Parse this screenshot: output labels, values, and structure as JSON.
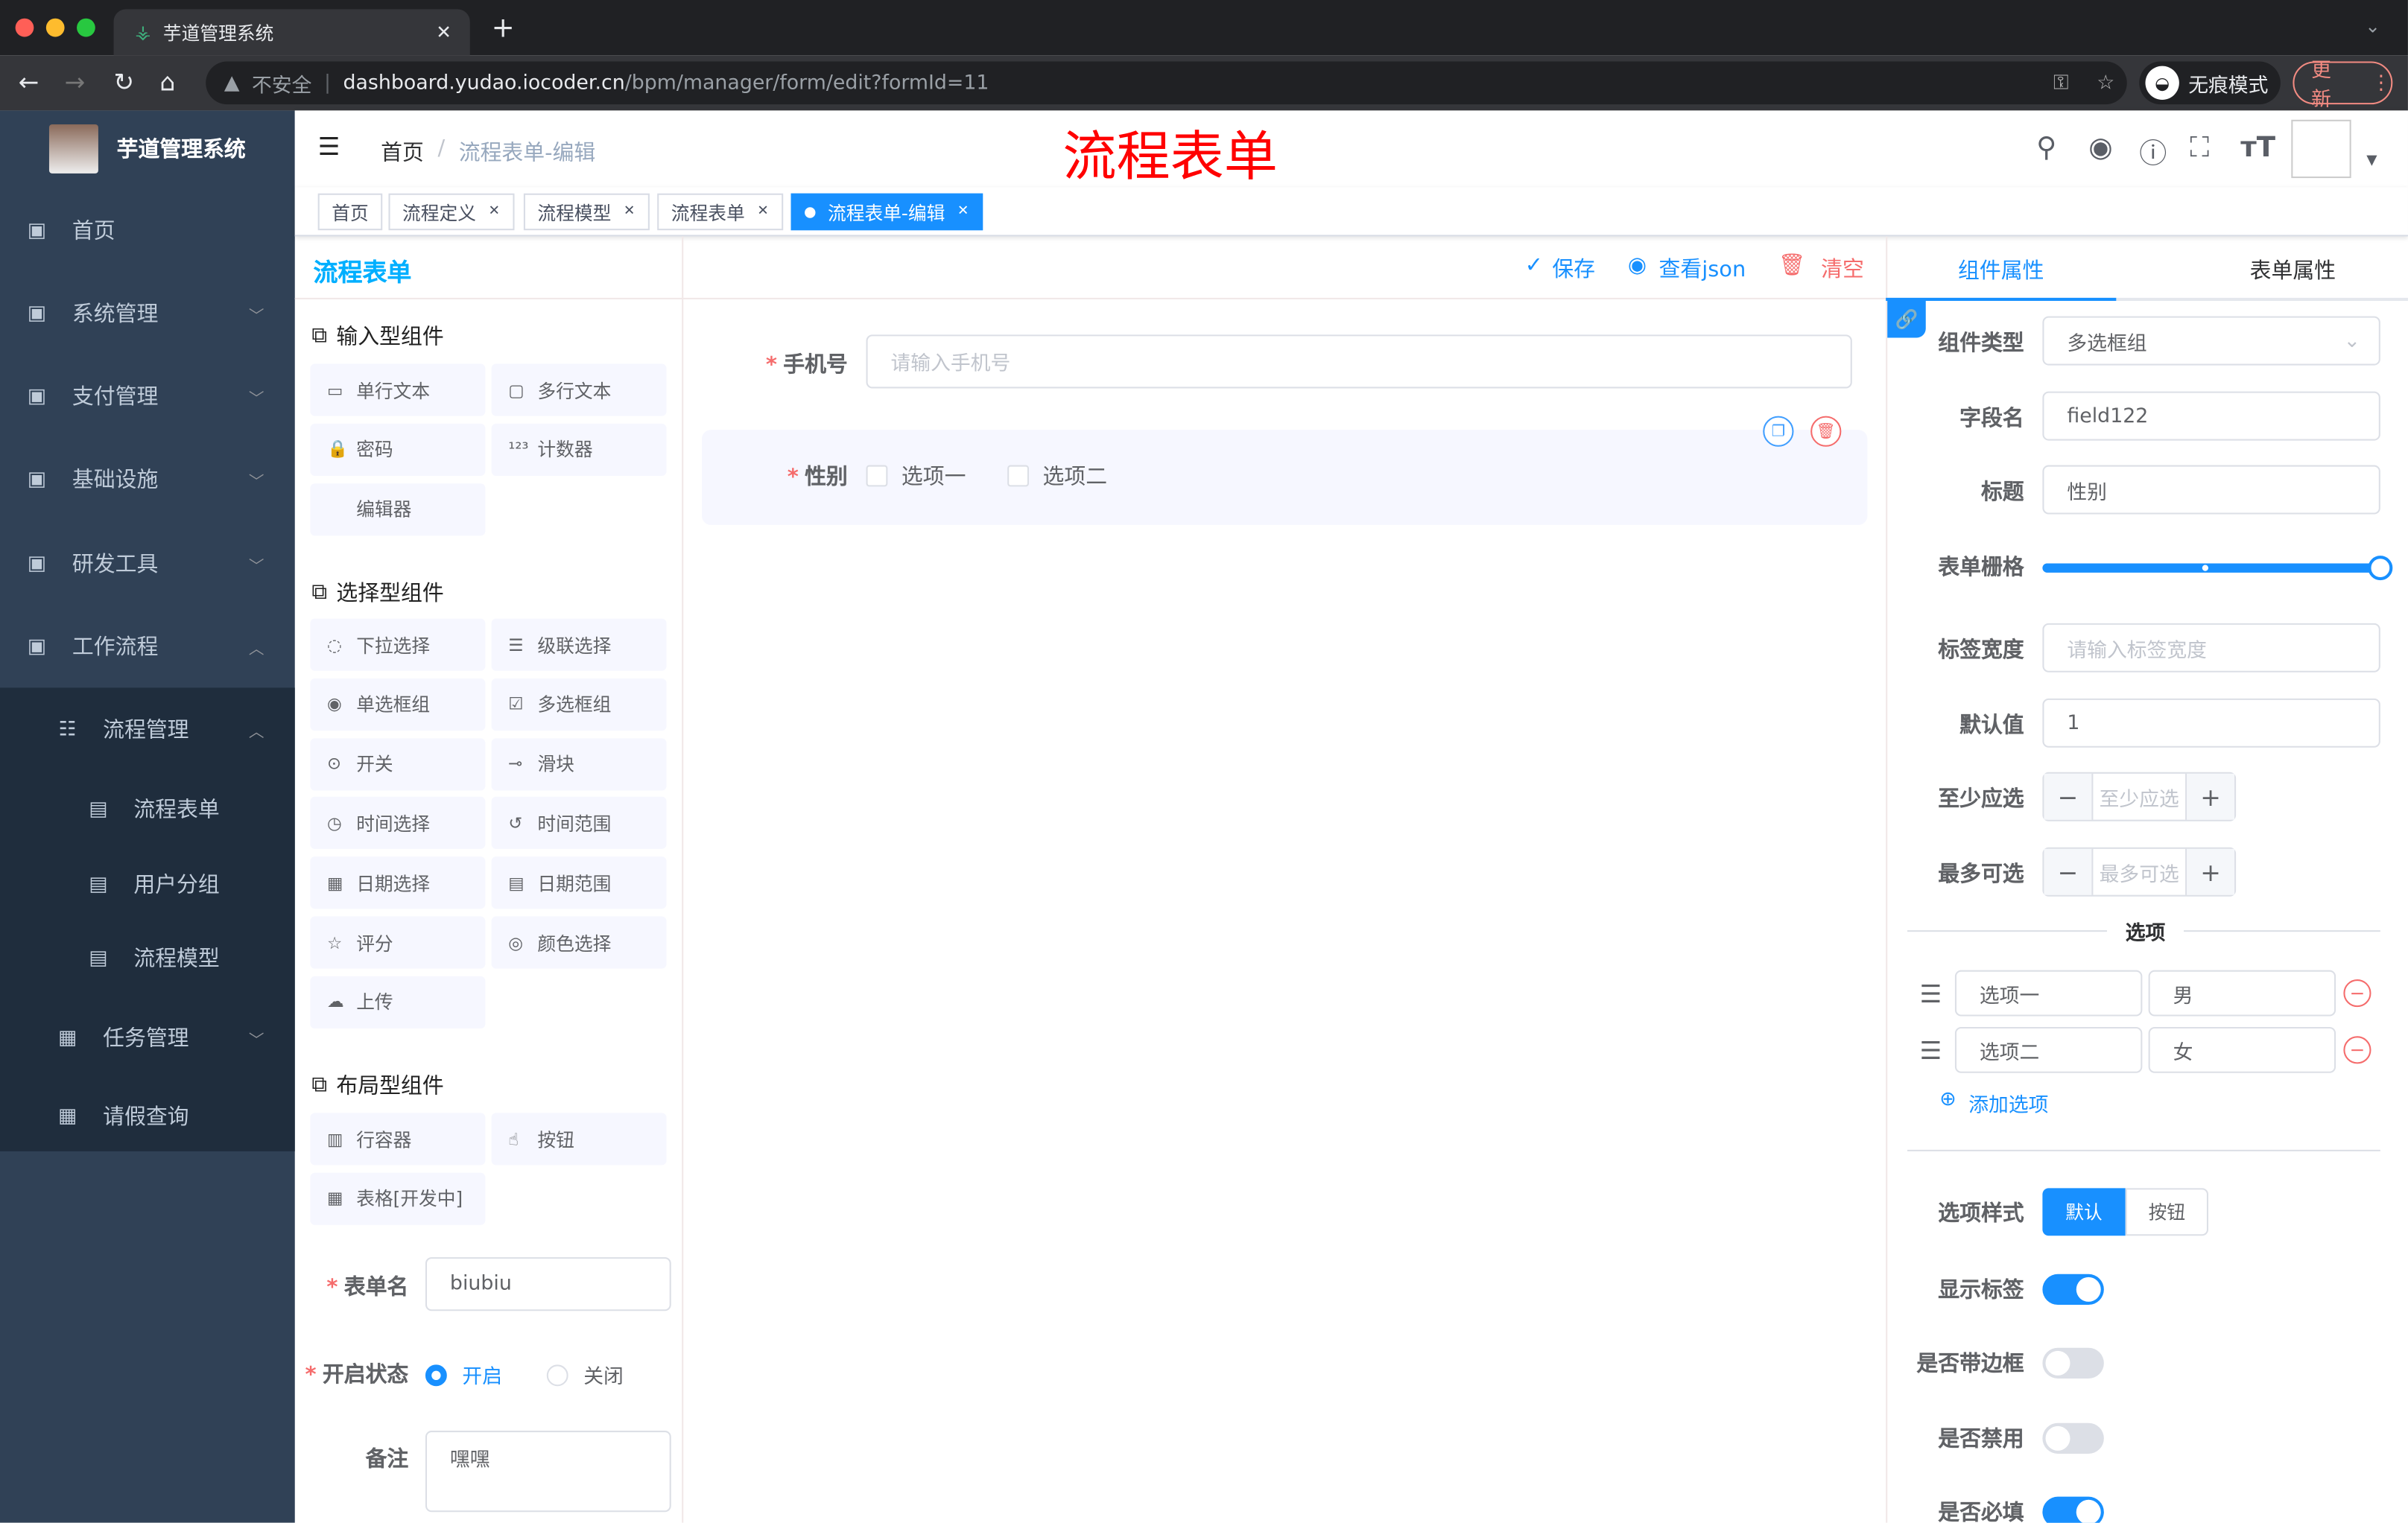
{
  "browser": {
    "tab_title": "芋道管理系统",
    "new_tab": "+",
    "insecure": "不安全",
    "url_host": "dashboard.yudao.iocoder.cn",
    "url_path": "/bpm/manager/form/edit?formId=11",
    "incognito": "无痕模式",
    "update": "更新"
  },
  "sidebar": {
    "title": "芋道管理系统",
    "items": [
      {
        "label": "首页",
        "icon": "dashboard-icon"
      },
      {
        "label": "系统管理",
        "icon": "gear-icon"
      },
      {
        "label": "支付管理",
        "icon": "yen-icon"
      },
      {
        "label": "基础设施",
        "icon": "monitor-icon"
      },
      {
        "label": "研发工具",
        "icon": "toolbox-icon"
      },
      {
        "label": "工作流程",
        "icon": "toolbox-icon"
      }
    ],
    "sub_group": "流程管理",
    "sub_items": [
      {
        "label": "流程表单",
        "icon": "form-icon"
      },
      {
        "label": "用户分组",
        "icon": "user-group-icon"
      },
      {
        "label": "流程模型",
        "icon": "send-icon"
      }
    ],
    "bottom_items": [
      {
        "label": "任务管理",
        "icon": "tree-icon"
      },
      {
        "label": "请假查询",
        "icon": "user-icon"
      }
    ]
  },
  "header": {
    "breadcrumb": [
      "首页",
      "流程表单-编辑"
    ],
    "overlay_title": "流程表单"
  },
  "tags": [
    {
      "label": "首页"
    },
    {
      "label": "流程定义"
    },
    {
      "label": "流程模型"
    },
    {
      "label": "流程表单"
    },
    {
      "label": "流程表单-编辑",
      "active": true
    }
  ],
  "left_panel": {
    "title": "流程表单",
    "sections": [
      {
        "title": "输入型组件",
        "items": [
          "单行文本",
          "多行文本",
          "密码",
          "计数器",
          "编辑器"
        ]
      },
      {
        "title": "选择型组件",
        "items": [
          "下拉选择",
          "级联选择",
          "单选框组",
          "多选框组",
          "开关",
          "滑块",
          "时间选择",
          "时间范围",
          "日期选择",
          "日期范围",
          "评分",
          "颜色选择",
          "上传"
        ]
      },
      {
        "title": "布局型组件",
        "items": [
          "行容器",
          "按钮",
          "表格[开发中]"
        ]
      }
    ],
    "form_name_label": "表单名",
    "form_name_value": "biubiu",
    "status_label": "开启状态",
    "status_on": "开启",
    "status_off": "关闭",
    "remark_label": "备注",
    "remark_value": "嘿嘿"
  },
  "toolbar": {
    "save": "保存",
    "view_json": "查看json",
    "clear": "清空"
  },
  "canvas": {
    "phone_label": "手机号",
    "phone_placeholder": "请输入手机号",
    "gender_label": "性别",
    "options": [
      "选项一",
      "选项二"
    ]
  },
  "right_panel": {
    "tabs": [
      "组件属性",
      "表单属性"
    ],
    "component_type_label": "组件类型",
    "component_type": "多选框组",
    "field_label": "字段名",
    "field_value": "field122",
    "title_label": "标题",
    "title_value": "性别",
    "grid_label": "表单栅格",
    "grid_value": 24,
    "grid_max": 24,
    "label_width_label": "标签宽度",
    "label_width_placeholder": "请输入标签宽度",
    "default_label": "默认值",
    "default_value": "1",
    "min_label": "至少应选",
    "min_placeholder": "至少应选",
    "max_label": "最多可选",
    "max_placeholder": "最多可选",
    "options_divider": "选项",
    "options": [
      {
        "label": "选项一",
        "value": "男"
      },
      {
        "label": "选项二",
        "value": "女"
      }
    ],
    "add_option": "添加选项",
    "style_label": "选项样式",
    "style_options": [
      "默认",
      "按钮"
    ],
    "style_selected": "默认",
    "show_label": "显示标签",
    "show_label_on": true,
    "border_label": "是否带边框",
    "border_on": false,
    "disabled_label": "是否禁用",
    "disabled_on": false,
    "required_label": "是否必填",
    "required_on": true
  },
  "colors": {
    "primary": "#1890ff",
    "sidebar": "#304156",
    "danger": "#f56c6c",
    "overlay_title": "#ff0000"
  }
}
